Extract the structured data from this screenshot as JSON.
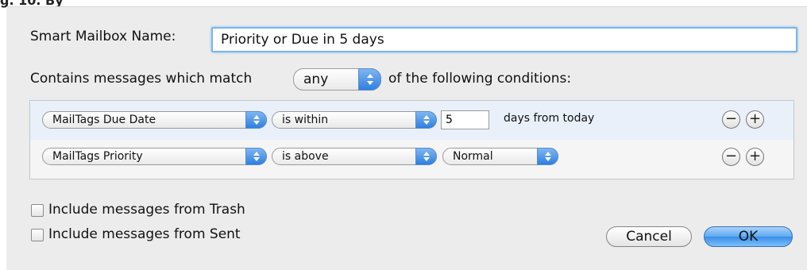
{
  "top_strip": {
    "text": "g. 10. By"
  },
  "dialog": {
    "name_label": "Smart Mailbox Name:",
    "name_value": "Priority or Due in 5 days",
    "match_prefix": "Contains messages which match",
    "match_value": "any",
    "match_suffix": "of the following conditions:",
    "conditions": [
      {
        "field": "MailTags Due Date",
        "operator": "is within",
        "value": "5",
        "suffix": "days from today"
      },
      {
        "field": "MailTags Priority",
        "operator": "is above",
        "value": "Normal"
      }
    ],
    "remove_glyph": "−",
    "add_glyph": "+",
    "include_trash": {
      "label": "Include messages from Trash",
      "checked": false
    },
    "include_sent": {
      "label": "Include messages from Sent",
      "checked": false
    },
    "cancel_label": "Cancel",
    "ok_label": "OK"
  }
}
